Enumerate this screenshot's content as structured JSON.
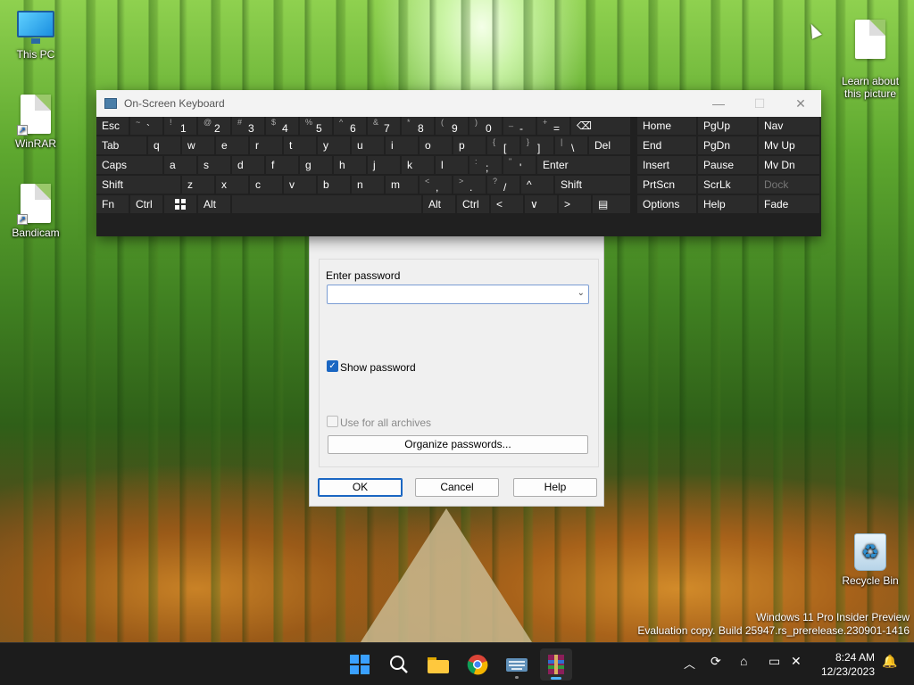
{
  "desktop": {
    "icons": [
      {
        "label": "This PC"
      },
      {
        "label": "WinRAR"
      },
      {
        "label": "Bandicam"
      },
      {
        "label": "Learn about\nthis picture"
      },
      {
        "label": "Recycle Bin"
      }
    ],
    "watermark": {
      "line1": "Windows 11 Pro Insider Preview",
      "line2": "Evaluation copy. Build 25947.rs_prerelease.230901-1416"
    }
  },
  "osk": {
    "title": "On-Screen Keyboard",
    "controls": {
      "minimize": "—",
      "maximize": "☐",
      "close": "✕"
    },
    "rows": [
      {
        "keys": [
          {
            "label": "Esc"
          },
          {
            "top": "~",
            "main": "`"
          },
          {
            "top": "!",
            "main": "1"
          },
          {
            "top": "@",
            "main": "2"
          },
          {
            "top": "#",
            "main": "3"
          },
          {
            "top": "$",
            "main": "4"
          },
          {
            "top": "%",
            "main": "5"
          },
          {
            "top": "^",
            "main": "6"
          },
          {
            "top": "&",
            "main": "7"
          },
          {
            "top": "*",
            "main": "8"
          },
          {
            "top": "(",
            "main": "9"
          },
          {
            "top": ")",
            "main": "0"
          },
          {
            "top": "_",
            "main": "-"
          },
          {
            "top": "+",
            "main": "="
          },
          {
            "label": "⌫"
          }
        ]
      },
      {
        "keys": [
          {
            "label": "Tab"
          },
          {
            "label": "q"
          },
          {
            "label": "w"
          },
          {
            "label": "e"
          },
          {
            "label": "r"
          },
          {
            "label": "t"
          },
          {
            "label": "y"
          },
          {
            "label": "u"
          },
          {
            "label": "i"
          },
          {
            "label": "o"
          },
          {
            "label": "p"
          },
          {
            "top": "{",
            "main": "["
          },
          {
            "top": "}",
            "main": "]"
          },
          {
            "top": "|",
            "main": "\\"
          },
          {
            "label": "Del"
          }
        ]
      },
      {
        "keys": [
          {
            "label": "Caps"
          },
          {
            "label": "a"
          },
          {
            "label": "s"
          },
          {
            "label": "d"
          },
          {
            "label": "f"
          },
          {
            "label": "g"
          },
          {
            "label": "h"
          },
          {
            "label": "j"
          },
          {
            "label": "k"
          },
          {
            "label": "l"
          },
          {
            "top": ":",
            "main": ";"
          },
          {
            "top": "\"",
            "main": "'"
          },
          {
            "label": "Enter"
          }
        ]
      },
      {
        "keys": [
          {
            "label": "Shift"
          },
          {
            "label": "z"
          },
          {
            "label": "x"
          },
          {
            "label": "c"
          },
          {
            "label": "v"
          },
          {
            "label": "b"
          },
          {
            "label": "n"
          },
          {
            "label": "m"
          },
          {
            "top": "<",
            "main": ","
          },
          {
            "top": ">",
            "main": "."
          },
          {
            "top": "?",
            "main": "/"
          },
          {
            "label": "^"
          },
          {
            "label": "Shift"
          }
        ]
      },
      {
        "keys": [
          {
            "label": "Fn"
          },
          {
            "label": "Ctrl"
          },
          {
            "label": ""
          },
          {
            "label": "Alt"
          },
          {
            "label": ""
          },
          {
            "label": "Alt"
          },
          {
            "label": "Ctrl"
          },
          {
            "label": "<"
          },
          {
            "label": "∨"
          },
          {
            "label": ">"
          },
          {
            "label": "▤"
          }
        ]
      }
    ],
    "nav": [
      [
        "Home",
        "PgUp",
        "Nav"
      ],
      [
        "End",
        "PgDn",
        "Mv Up"
      ],
      [
        "Insert",
        "Pause",
        "Mv Dn"
      ],
      [
        "PrtScn",
        "ScrLk",
        "Dock"
      ],
      [
        "Options",
        "Help",
        "Fade"
      ]
    ]
  },
  "dialog": {
    "password_label": "Enter password",
    "password_value": "",
    "show_password": {
      "label": "Show password",
      "checked": true
    },
    "use_for_all": {
      "label": "Use for all archives",
      "checked": false
    },
    "organize_label": "Organize passwords...",
    "ok_label": "OK",
    "cancel_label": "Cancel",
    "help_label": "Help"
  },
  "taskbar": {
    "apps": [
      "start-icon",
      "search-icon",
      "file-explorer-icon",
      "chrome-icon",
      "keyboard-app-icon",
      "winrar-icon"
    ],
    "time": "8:24 AM",
    "date": "12/23/2023"
  }
}
